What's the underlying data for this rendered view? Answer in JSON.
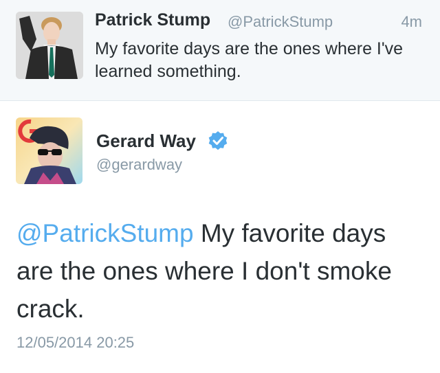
{
  "original_tweet": {
    "name": "Patrick Stump",
    "handle": "@PatrickStump",
    "time": "4m",
    "text": "My favorite days are the ones where I've learned something."
  },
  "reply_tweet": {
    "name": "Gerard Way",
    "handle": "@gerardway",
    "mention": "@PatrickStump",
    "text": " My favorite days are the ones where I don't smoke crack.",
    "timestamp": "12/05/2014 20:25",
    "verified_icon": "verified-badge-icon"
  },
  "colors": {
    "accent": "#55acee",
    "muted": "#8899a6",
    "text": "#292f33",
    "orig_bg": "#f5f8fa"
  }
}
